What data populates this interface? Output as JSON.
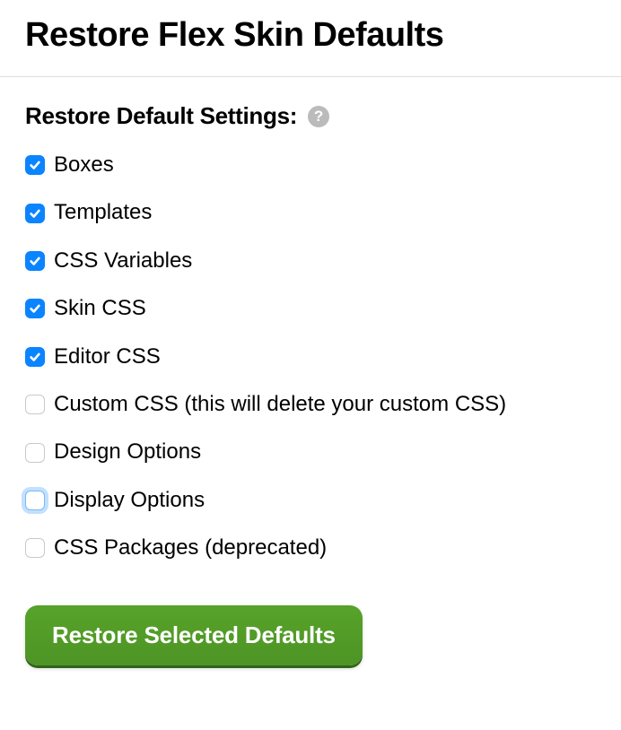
{
  "page_title": "Restore Flex Skin Defaults",
  "section_title": "Restore Default Settings:",
  "help_glyph": "?",
  "options": [
    {
      "label": "Boxes",
      "checked": true,
      "focused": false
    },
    {
      "label": "Templates",
      "checked": true,
      "focused": false
    },
    {
      "label": "CSS Variables",
      "checked": true,
      "focused": false
    },
    {
      "label": "Skin CSS",
      "checked": true,
      "focused": false
    },
    {
      "label": "Editor CSS",
      "checked": true,
      "focused": false
    },
    {
      "label": "Custom CSS (this will delete your custom CSS)",
      "checked": false,
      "focused": false
    },
    {
      "label": "Design Options",
      "checked": false,
      "focused": false
    },
    {
      "label": "Display Options",
      "checked": false,
      "focused": true
    },
    {
      "label": "CSS Packages (deprecated)",
      "checked": false,
      "focused": false
    }
  ],
  "button_label": "Restore Selected Defaults"
}
